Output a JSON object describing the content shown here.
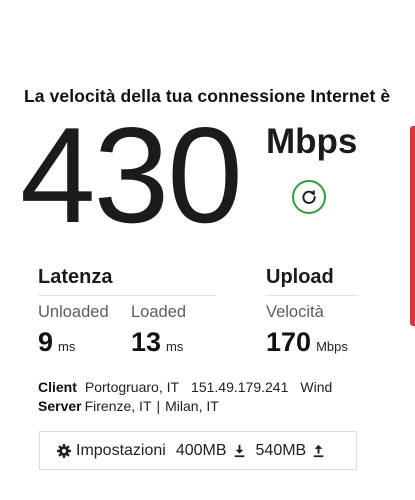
{
  "headline": "La velocità della tua connessione Internet è",
  "speed": {
    "value": "430",
    "unit": "Mbps",
    "refresh_icon": "refresh-icon"
  },
  "latency": {
    "title": "Latenza",
    "unloaded_label": "Unloaded",
    "unloaded_value": "9",
    "unloaded_unit": "ms",
    "loaded_label": "Loaded",
    "loaded_value": "13",
    "loaded_unit": "ms"
  },
  "upload": {
    "title": "Upload",
    "speed_label": "Velocità",
    "speed_value": "170",
    "speed_unit": "Mbps"
  },
  "client": {
    "label": "Client",
    "location": "Portogruaro, IT",
    "ip": "151.49.179.241",
    "isp": "Wind"
  },
  "server": {
    "label": "Server",
    "location_1": "Firenze, IT",
    "separator": "|",
    "location_2": "Milan, IT"
  },
  "settings": {
    "label": "Impostazioni",
    "download_size": "400MB",
    "upload_size": "540MB",
    "gear_icon": "gear-icon",
    "download_icon": "download-icon",
    "upload_icon": "upload-icon"
  },
  "colors": {
    "refresh_accent": "#2e9d3f",
    "edge_accent": "#d9363e",
    "text": "#1b1b1b",
    "muted_text": "#5d5d5d"
  }
}
